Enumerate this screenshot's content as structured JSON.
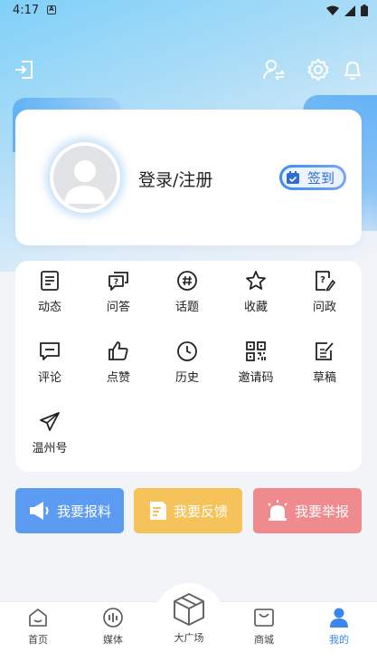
{
  "status_bar": {
    "time": "4:17",
    "app_badge": "A"
  },
  "profile": {
    "login_label": "登录/注册",
    "signin_label": "签到"
  },
  "functions": [
    {
      "label": "动态",
      "icon": "news-list-icon"
    },
    {
      "label": "问答",
      "icon": "question-chat-icon"
    },
    {
      "label": "话题",
      "icon": "hashtag-icon"
    },
    {
      "label": "收藏",
      "icon": "star-icon"
    },
    {
      "label": "问政",
      "icon": "question-doc-icon"
    },
    {
      "label": "评论",
      "icon": "comment-icon"
    },
    {
      "label": "点赞",
      "icon": "thumbs-up-icon"
    },
    {
      "label": "历史",
      "icon": "clock-icon"
    },
    {
      "label": "邀请码",
      "icon": "qr-code-icon"
    },
    {
      "label": "草稿",
      "icon": "draft-icon"
    },
    {
      "label": "温州号",
      "icon": "paper-plane-icon"
    }
  ],
  "actions": [
    {
      "label": "我要报料",
      "color": "#5b9cf2"
    },
    {
      "label": "我要反馈",
      "color": "#f6c35a"
    },
    {
      "label": "我要举报",
      "color": "#ef8a8e"
    }
  ],
  "bottom_nav": [
    {
      "label": "首页",
      "icon": "home-icon"
    },
    {
      "label": "媒体",
      "icon": "media-icon"
    },
    {
      "label": "大广场",
      "icon": "cube-icon"
    },
    {
      "label": "商城",
      "icon": "mall-icon"
    },
    {
      "label": "我的",
      "icon": "user-icon",
      "active": true
    }
  ],
  "colors": {
    "accent": "#3a86ee",
    "text": "#222222"
  }
}
